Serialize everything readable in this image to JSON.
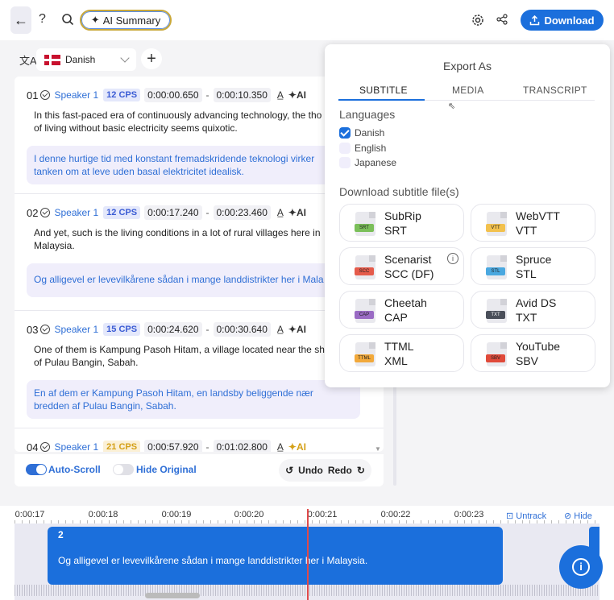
{
  "toolbar": {
    "help": "?",
    "ai_summary_label": "AI Summary",
    "download_label": "Download"
  },
  "language_selector": {
    "selected": "Danish"
  },
  "subtitles": [
    {
      "index": "01",
      "speaker": "Speaker 1",
      "cps": "12 CPS",
      "start": "0:00:00.650",
      "end": "0:00:10.350",
      "original": "In this fast-paced era of continuously advancing technology, the tho",
      "original_line2": "of living without basic electricity seems quixotic.",
      "translation": "I denne hurtige tid med konstant fremadskridende teknologi virker",
      "translation_line2": "tanken om at leve uden basal elektricitet idealisk."
    },
    {
      "index": "02",
      "speaker": "Speaker 1",
      "cps": "12 CPS",
      "start": "0:00:17.240",
      "end": "0:00:23.460",
      "original": "And yet, such is the living conditions in a lot of rural villages here in",
      "original_line2": "Malaysia.",
      "translation": "Og alligevel er levevilkårene sådan i mange landdistrikter her i Mala",
      "translation_line2": ""
    },
    {
      "index": "03",
      "speaker": "Speaker 1",
      "cps": "15 CPS",
      "start": "0:00:24.620",
      "end": "0:00:30.640",
      "original": "One of them is Kampung Pasoh Hitam, a village located near the sh",
      "original_line2": "of Pulau Bangin, Sabah.",
      "translation": "En af dem er Kampung Pasoh Hitam, en landsby beliggende nær",
      "translation_line2": "bredden af Pulau Bangin, Sabah."
    },
    {
      "index": "04",
      "speaker": "Speaker 1",
      "cps": "21 CPS",
      "start": "0:00:57.920",
      "end": "0:01:02.800"
    }
  ],
  "controls": {
    "auto_scroll": "Auto-Scroll",
    "auto_scroll_on": true,
    "hide_original": "Hide Original",
    "hide_original_on": false,
    "undo": "Undo",
    "redo": "Redo"
  },
  "export": {
    "title": "Export As",
    "tabs": [
      "SUBTITLE",
      "MEDIA",
      "TRANSCRIPT"
    ],
    "active_tab": "SUBTITLE",
    "languages_heading": "Languages",
    "languages": [
      {
        "name": "Danish",
        "checked": true
      },
      {
        "name": "English",
        "checked": false
      },
      {
        "name": "Japanese",
        "checked": false
      }
    ],
    "files_heading": "Download subtitle file(s)",
    "formats": [
      {
        "name": "SubRip",
        "ext": "SRT",
        "tag": "SRT",
        "color": "#7bbf5a"
      },
      {
        "name": "WebVTT",
        "ext": "VTT",
        "tag": "VTT",
        "color": "#f2c14e"
      },
      {
        "name": "Scenarist",
        "ext": "SCC (DF)",
        "tag": "SCC",
        "color": "#e55b4b"
      },
      {
        "name": "Spruce",
        "ext": "STL",
        "tag": "STL",
        "color": "#4aa8e0"
      },
      {
        "name": "Cheetah",
        "ext": "CAP",
        "tag": "CAP",
        "color": "#9a6bc4"
      },
      {
        "name": "Avid DS",
        "ext": "TXT",
        "tag": "TXT",
        "color": "#4a4f5a"
      },
      {
        "name": "TTML",
        "ext": "XML",
        "tag": "TTML",
        "color": "#f2a93b"
      },
      {
        "name": "YouTube",
        "ext": "SBV",
        "tag": "SBV",
        "color": "#e04a3a"
      }
    ]
  },
  "timeline": {
    "ticks": [
      "0:00:17",
      "0:00:18",
      "0:00:19",
      "0:00:20",
      "0:00:21",
      "0:00:22",
      "0:00:23"
    ],
    "untrack": "Untrack",
    "hide": "Hide",
    "caption_number": "2",
    "caption_text": "Og alligevel er levevilkårene sådan i mange landdistrikter her i Malaysia."
  },
  "colors": {
    "accent": "#1b6fdc",
    "speaker": "#2f6fd6",
    "cps_warn": "#d4a017"
  }
}
